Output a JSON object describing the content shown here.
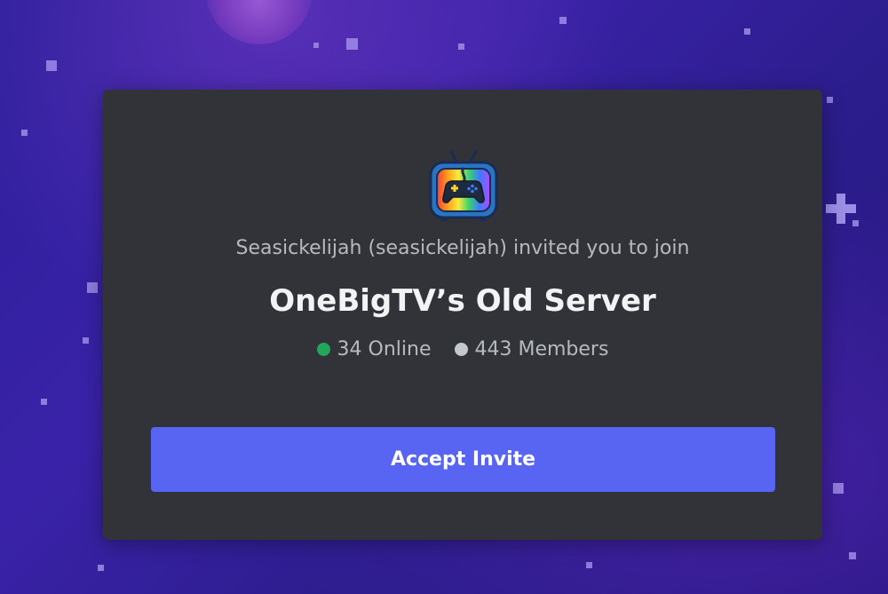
{
  "invite": {
    "inviter_text": "Seasickelijah (seasickelijah) invited you to join",
    "server_name": "OneBigTV’s Old Server",
    "online_count": "34 Online",
    "member_count": "443 Members",
    "accept_label": "Accept Invite",
    "server_icon": "retro-tv-gamepad-icon"
  },
  "colors": {
    "card_background": "#313338",
    "accept_button": "#5865f2",
    "online_dot": "#23a55a",
    "members_dot": "#c4c9ce"
  }
}
